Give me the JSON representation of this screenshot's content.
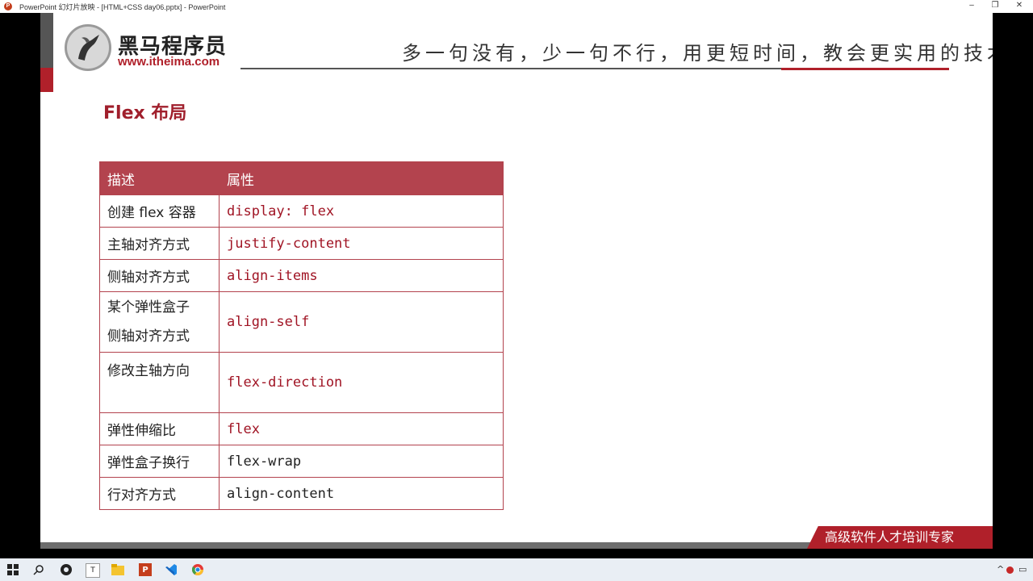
{
  "window": {
    "app_icon": "P",
    "title": "PowerPoint 幻灯片放映 - [HTML+CSS day06.pptx] - PowerPoint",
    "controls": [
      "–",
      "❐",
      "✕"
    ]
  },
  "slide": {
    "logo_cn": "黑马程序员",
    "logo_en": "www.itheima.com",
    "slogan": "多一句没有，少一句不行，用更短时间，教会更实用的技术！",
    "title": "Flex 布局",
    "table": {
      "headers": [
        "描述",
        "属性"
      ],
      "rows": [
        {
          "desc": "创建 flex 容器",
          "prop": "display: flex"
        },
        {
          "desc": "主轴对齐方式",
          "prop": "justify-content"
        },
        {
          "desc": "侧轴对齐方式",
          "prop": "align-items"
        },
        {
          "desc_line1": "某个弹性盒子",
          "desc_line2": "侧轴对齐方式",
          "prop": "align-self"
        },
        {
          "desc": "修改主轴方向",
          "prop": "flex-direction"
        },
        {
          "desc": "弹性伸缩比",
          "prop": "flex"
        },
        {
          "desc": "弹性盒子换行",
          "prop": "flex-wrap"
        },
        {
          "desc": "行对齐方式",
          "prop": "align-content"
        }
      ]
    },
    "banner": "高级软件人才培训专家",
    "colors": {
      "accent": "#b0202a",
      "header": "#b3434e",
      "code_red": "#a01424"
    }
  },
  "taskbar": {
    "icons": [
      "windows-start",
      "search",
      "obs",
      "typora",
      "file-explorer",
      "powerpoint",
      "vscode",
      "chrome"
    ]
  }
}
